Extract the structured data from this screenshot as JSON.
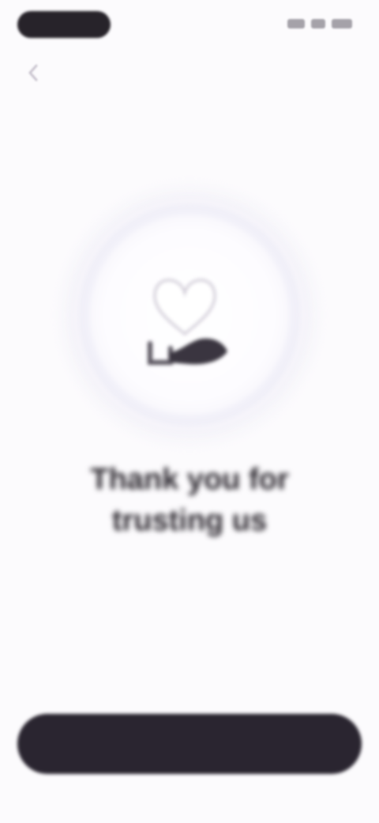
{
  "status_bar": {
    "pill_icon": "dynamic-island",
    "icons": [
      "signal-icon",
      "wifi-icon",
      "battery-icon"
    ]
  },
  "nav": {
    "back_icon": "chevron-left-icon",
    "title": ""
  },
  "illustration": {
    "icon": "heart-hands-icon"
  },
  "content": {
    "title": "Thank you for trusting us",
    "subtitle": ""
  },
  "primary_action": {
    "label": ""
  },
  "colors": {
    "background": "#fcfbfd",
    "button_background": "#2a2530",
    "title_text": "#2a262d",
    "muted_text": "#b5b0ba"
  }
}
